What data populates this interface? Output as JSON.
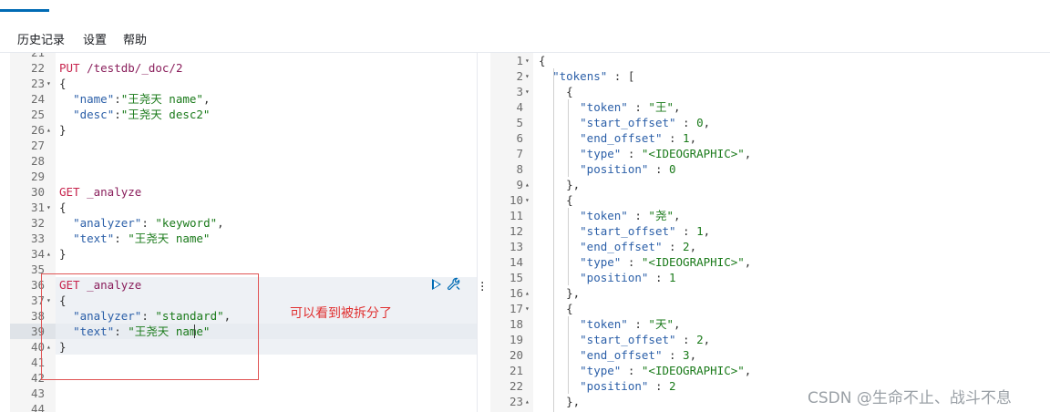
{
  "menu": {
    "items": [
      "历史记录",
      "设置",
      "帮助"
    ]
  },
  "left_editor": {
    "lines": [
      {
        "n": "21",
        "fold": "",
        "segs": []
      },
      {
        "n": "22",
        "fold": "",
        "segs": [
          [
            "k-method",
            "PUT "
          ],
          [
            "k-path",
            "/testdb/_doc/2"
          ]
        ]
      },
      {
        "n": "23",
        "fold": "▾",
        "segs": [
          [
            "k-punc",
            "{"
          ]
        ]
      },
      {
        "n": "24",
        "fold": "",
        "segs": [
          [
            "k-punc",
            "  "
          ],
          [
            "k-key",
            "\"name\""
          ],
          [
            "k-punc",
            ":"
          ],
          [
            "k-str",
            "\"王尧天 name\""
          ],
          [
            "k-punc",
            ","
          ]
        ]
      },
      {
        "n": "25",
        "fold": "",
        "segs": [
          [
            "k-punc",
            "  "
          ],
          [
            "k-key",
            "\"desc\""
          ],
          [
            "k-punc",
            ":"
          ],
          [
            "k-str",
            "\"王尧天 desc2\""
          ]
        ]
      },
      {
        "n": "26",
        "fold": "▴",
        "segs": [
          [
            "k-punc",
            "}"
          ]
        ]
      },
      {
        "n": "27",
        "fold": "",
        "segs": []
      },
      {
        "n": "28",
        "fold": "",
        "segs": []
      },
      {
        "n": "29",
        "fold": "",
        "segs": []
      },
      {
        "n": "30",
        "fold": "",
        "segs": [
          [
            "k-method",
            "GET "
          ],
          [
            "k-path",
            "_analyze"
          ]
        ]
      },
      {
        "n": "31",
        "fold": "▾",
        "segs": [
          [
            "k-punc",
            "{"
          ]
        ]
      },
      {
        "n": "32",
        "fold": "",
        "segs": [
          [
            "k-punc",
            "  "
          ],
          [
            "k-key",
            "\"analyzer\""
          ],
          [
            "k-punc",
            ": "
          ],
          [
            "k-str",
            "\"keyword\""
          ],
          [
            "k-punc",
            ","
          ]
        ]
      },
      {
        "n": "33",
        "fold": "",
        "segs": [
          [
            "k-punc",
            "  "
          ],
          [
            "k-key",
            "\"text\""
          ],
          [
            "k-punc",
            ": "
          ],
          [
            "k-str",
            "\"王尧天 name\""
          ]
        ]
      },
      {
        "n": "34",
        "fold": "▴",
        "segs": [
          [
            "k-punc",
            "}"
          ]
        ]
      },
      {
        "n": "35",
        "fold": "",
        "segs": []
      },
      {
        "n": "36",
        "fold": "",
        "segs": [
          [
            "k-method",
            "GET "
          ],
          [
            "k-path",
            "_analyze"
          ]
        ]
      },
      {
        "n": "37",
        "fold": "▾",
        "segs": [
          [
            "k-punc",
            "{"
          ]
        ]
      },
      {
        "n": "38",
        "fold": "",
        "segs": [
          [
            "k-punc",
            "  "
          ],
          [
            "k-key",
            "\"analyzer\""
          ],
          [
            "k-punc",
            ": "
          ],
          [
            "k-str",
            "\"standard\""
          ],
          [
            "k-punc",
            ","
          ]
        ]
      },
      {
        "n": "39",
        "fold": "",
        "segs": [
          [
            "k-punc",
            "  "
          ],
          [
            "k-key",
            "\"text\""
          ],
          [
            "k-punc",
            ": "
          ],
          [
            "k-str",
            "\"王尧天 name\""
          ]
        ]
      },
      {
        "n": "40",
        "fold": "▴",
        "segs": [
          [
            "k-punc",
            "}"
          ]
        ]
      },
      {
        "n": "41",
        "fold": "",
        "segs": []
      },
      {
        "n": "42",
        "fold": "",
        "segs": []
      },
      {
        "n": "43",
        "fold": "",
        "segs": []
      },
      {
        "n": "44",
        "fold": "",
        "segs": []
      }
    ]
  },
  "annotation": "可以看到被拆分了",
  "right_editor": {
    "lines": [
      {
        "n": "1",
        "fold": "▾",
        "segs": [
          [
            "k-punc",
            "{"
          ]
        ]
      },
      {
        "n": "2",
        "fold": "▾",
        "segs": [
          [
            "k-punc",
            "  "
          ],
          [
            "r-key",
            "\"tokens\""
          ],
          [
            "k-punc",
            " : ["
          ]
        ]
      },
      {
        "n": "3",
        "fold": "▾",
        "segs": [
          [
            "k-punc",
            "    {"
          ]
        ]
      },
      {
        "n": "4",
        "fold": "",
        "segs": [
          [
            "k-punc",
            "      "
          ],
          [
            "r-key",
            "\"token\""
          ],
          [
            "k-punc",
            " : "
          ],
          [
            "r-str",
            "\"王\""
          ],
          [
            "k-punc",
            ","
          ]
        ]
      },
      {
        "n": "5",
        "fold": "",
        "segs": [
          [
            "k-punc",
            "      "
          ],
          [
            "r-key",
            "\"start_offset\""
          ],
          [
            "k-punc",
            " : "
          ],
          [
            "r-num",
            "0"
          ],
          [
            "k-punc",
            ","
          ]
        ]
      },
      {
        "n": "6",
        "fold": "",
        "segs": [
          [
            "k-punc",
            "      "
          ],
          [
            "r-key",
            "\"end_offset\""
          ],
          [
            "k-punc",
            " : "
          ],
          [
            "r-num",
            "1"
          ],
          [
            "k-punc",
            ","
          ]
        ]
      },
      {
        "n": "7",
        "fold": "",
        "segs": [
          [
            "k-punc",
            "      "
          ],
          [
            "r-key",
            "\"type\""
          ],
          [
            "k-punc",
            " : "
          ],
          [
            "r-str",
            "\"<IDEOGRAPHIC>\""
          ],
          [
            "k-punc",
            ","
          ]
        ]
      },
      {
        "n": "8",
        "fold": "",
        "segs": [
          [
            "k-punc",
            "      "
          ],
          [
            "r-key",
            "\"position\""
          ],
          [
            "k-punc",
            " : "
          ],
          [
            "r-num",
            "0"
          ]
        ]
      },
      {
        "n": "9",
        "fold": "▴",
        "segs": [
          [
            "k-punc",
            "    },"
          ]
        ]
      },
      {
        "n": "10",
        "fold": "▾",
        "segs": [
          [
            "k-punc",
            "    {"
          ]
        ]
      },
      {
        "n": "11",
        "fold": "",
        "segs": [
          [
            "k-punc",
            "      "
          ],
          [
            "r-key",
            "\"token\""
          ],
          [
            "k-punc",
            " : "
          ],
          [
            "r-str",
            "\"尧\""
          ],
          [
            "k-punc",
            ","
          ]
        ]
      },
      {
        "n": "12",
        "fold": "",
        "segs": [
          [
            "k-punc",
            "      "
          ],
          [
            "r-key",
            "\"start_offset\""
          ],
          [
            "k-punc",
            " : "
          ],
          [
            "r-num",
            "1"
          ],
          [
            "k-punc",
            ","
          ]
        ]
      },
      {
        "n": "13",
        "fold": "",
        "segs": [
          [
            "k-punc",
            "      "
          ],
          [
            "r-key",
            "\"end_offset\""
          ],
          [
            "k-punc",
            " : "
          ],
          [
            "r-num",
            "2"
          ],
          [
            "k-punc",
            ","
          ]
        ]
      },
      {
        "n": "14",
        "fold": "",
        "segs": [
          [
            "k-punc",
            "      "
          ],
          [
            "r-key",
            "\"type\""
          ],
          [
            "k-punc",
            " : "
          ],
          [
            "r-str",
            "\"<IDEOGRAPHIC>\""
          ],
          [
            "k-punc",
            ","
          ]
        ]
      },
      {
        "n": "15",
        "fold": "",
        "segs": [
          [
            "k-punc",
            "      "
          ],
          [
            "r-key",
            "\"position\""
          ],
          [
            "k-punc",
            " : "
          ],
          [
            "r-num",
            "1"
          ]
        ]
      },
      {
        "n": "16",
        "fold": "▴",
        "segs": [
          [
            "k-punc",
            "    },"
          ]
        ]
      },
      {
        "n": "17",
        "fold": "▾",
        "segs": [
          [
            "k-punc",
            "    {"
          ]
        ]
      },
      {
        "n": "18",
        "fold": "",
        "segs": [
          [
            "k-punc",
            "      "
          ],
          [
            "r-key",
            "\"token\""
          ],
          [
            "k-punc",
            " : "
          ],
          [
            "r-str",
            "\"天\""
          ],
          [
            "k-punc",
            ","
          ]
        ]
      },
      {
        "n": "19",
        "fold": "",
        "segs": [
          [
            "k-punc",
            "      "
          ],
          [
            "r-key",
            "\"start_offset\""
          ],
          [
            "k-punc",
            " : "
          ],
          [
            "r-num",
            "2"
          ],
          [
            "k-punc",
            ","
          ]
        ]
      },
      {
        "n": "20",
        "fold": "",
        "segs": [
          [
            "k-punc",
            "      "
          ],
          [
            "r-key",
            "\"end_offset\""
          ],
          [
            "k-punc",
            " : "
          ],
          [
            "r-num",
            "3"
          ],
          [
            "k-punc",
            ","
          ]
        ]
      },
      {
        "n": "21",
        "fold": "",
        "segs": [
          [
            "k-punc",
            "      "
          ],
          [
            "r-key",
            "\"type\""
          ],
          [
            "k-punc",
            " : "
          ],
          [
            "r-str",
            "\"<IDEOGRAPHIC>\""
          ],
          [
            "k-punc",
            ","
          ]
        ]
      },
      {
        "n": "22",
        "fold": "",
        "segs": [
          [
            "k-punc",
            "      "
          ],
          [
            "r-key",
            "\"position\""
          ],
          [
            "k-punc",
            " : "
          ],
          [
            "r-num",
            "2"
          ]
        ]
      },
      {
        "n": "23",
        "fold": "▴",
        "segs": [
          [
            "k-punc",
            "    },"
          ]
        ]
      }
    ]
  },
  "icons": {
    "run": "play-icon",
    "wrench": "wrench-icon",
    "resize": "vertical-dots-icon"
  },
  "watermark": "CSDN @生命不止、战斗不息"
}
